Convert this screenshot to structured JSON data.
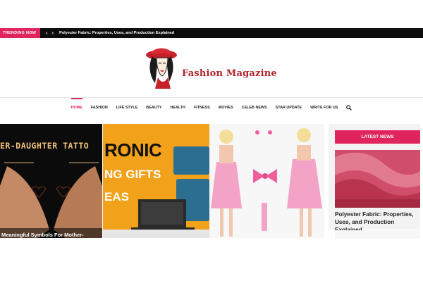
{
  "trending": {
    "label": "TRENDING NOW",
    "prev_icon": "chevron-left-icon",
    "next_icon": "chevron-right-icon",
    "title": "Polyester Fabric: Properties, Uses, and Production Explained"
  },
  "logo": {
    "text": "Fashion Magazine"
  },
  "nav": {
    "items": [
      {
        "label": "HOME"
      },
      {
        "label": "FASHION"
      },
      {
        "label": "LIFE STYLE"
      },
      {
        "label": "BEAUTY"
      },
      {
        "label": "HEALTH"
      },
      {
        "label": "FITNESS"
      },
      {
        "label": "MOVIES"
      },
      {
        "label": "CELEB NEWS"
      },
      {
        "label": "STAR UPDATE"
      },
      {
        "label": "WRITE FOR US"
      }
    ],
    "search_icon": "search-icon"
  },
  "slider": {
    "slide1": {
      "title": "ER-DAUGHTER TATTO",
      "caption": "Meaningful Symbols For Mother-"
    },
    "slide2": {
      "line1": "RONIC",
      "line2": "NG GIFTS",
      "line3": "EAS"
    }
  },
  "sidebar": {
    "tab": "LATEST NEWS",
    "image_caption": "Polyester Fabric: Properties, Uses, and Production Explained",
    "headline": "Polyester Fabric: Properties, Uses, and Production Explained"
  },
  "colors": {
    "accent": "#e0245e",
    "logo": "#b0252c",
    "topbar": "#0d0d0d"
  }
}
